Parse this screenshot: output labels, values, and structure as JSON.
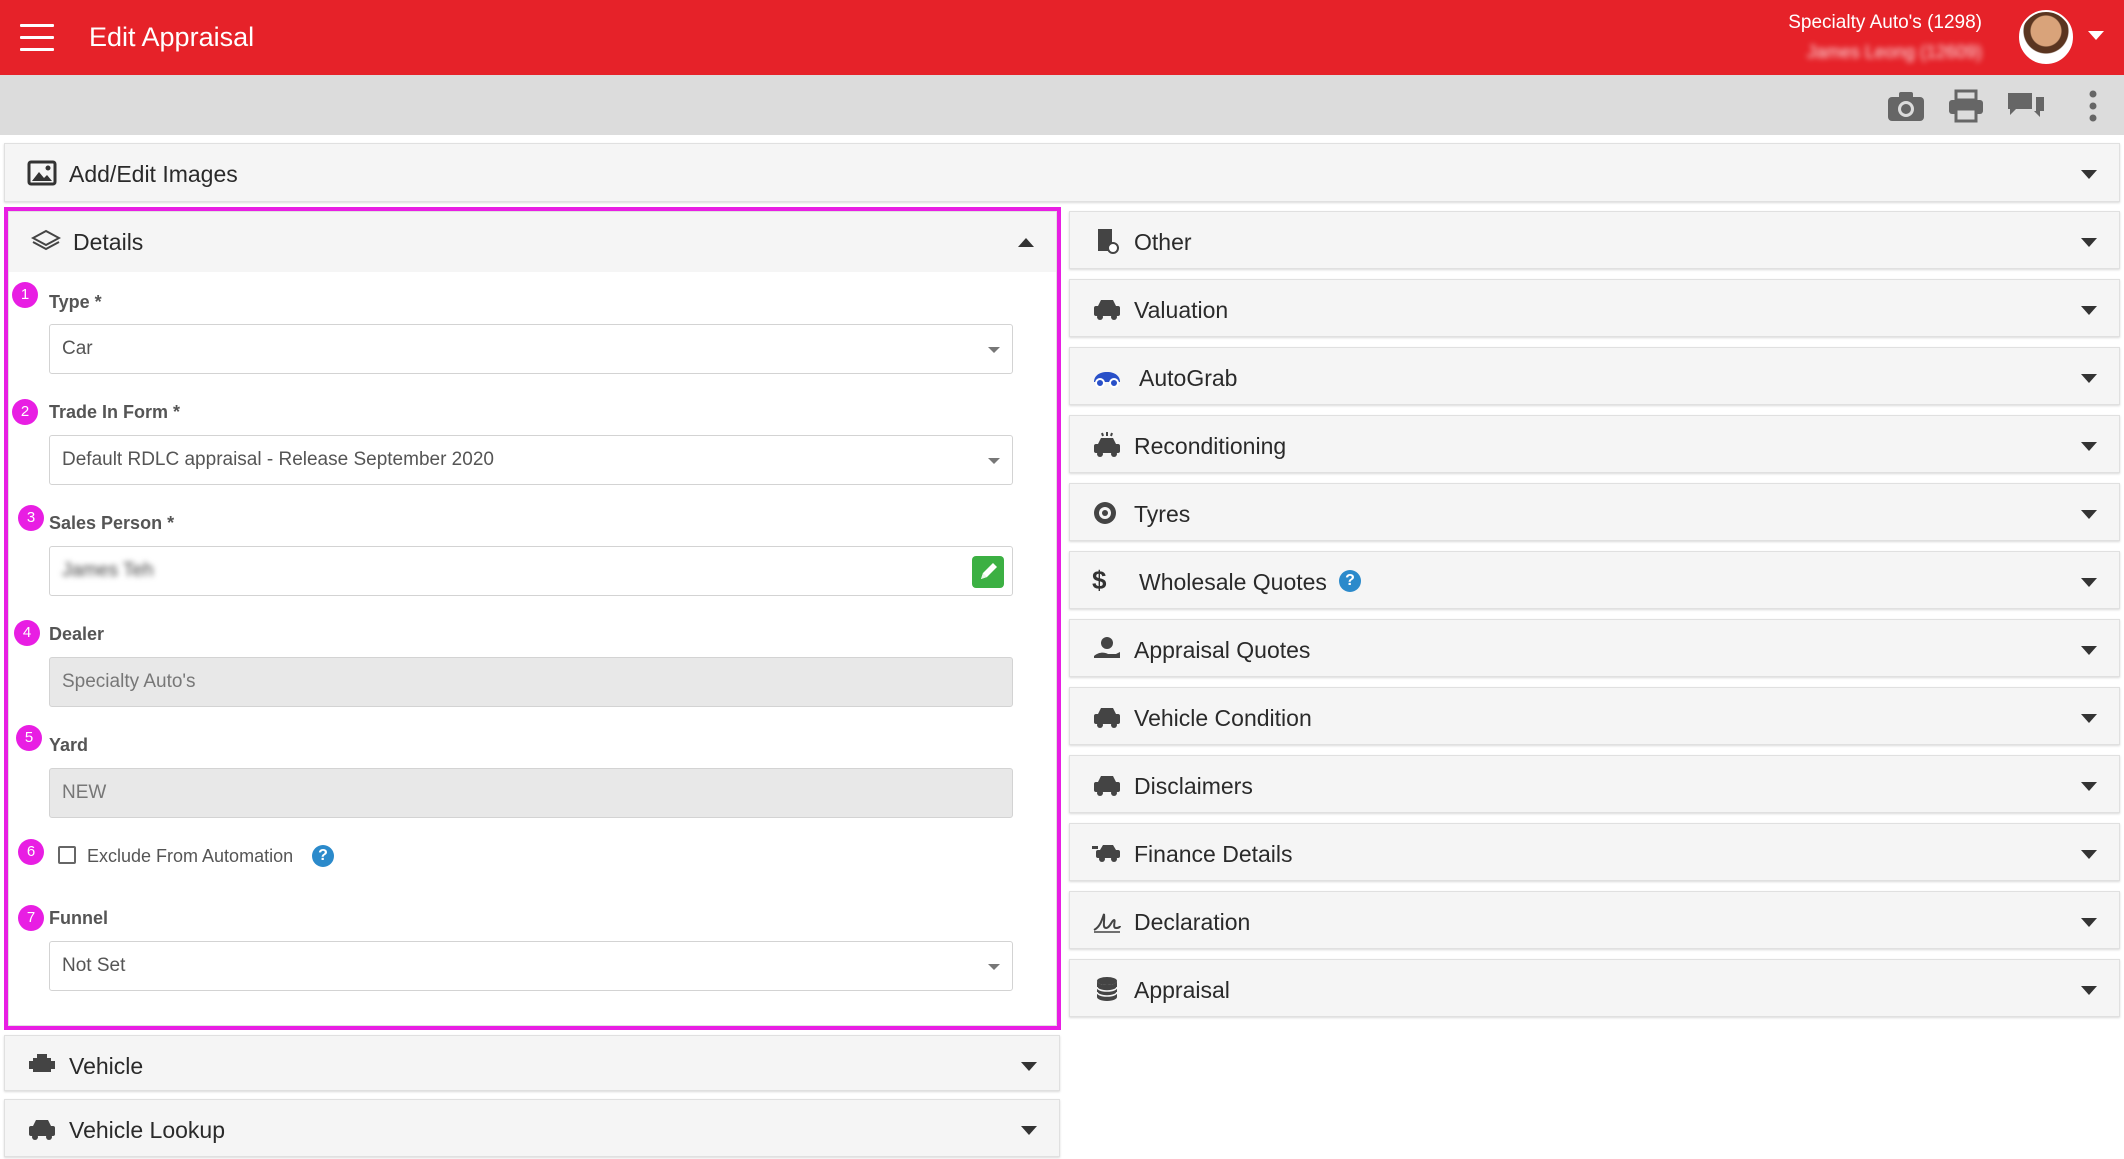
{
  "appbar": {
    "title": "Edit Appraisal",
    "dealer": "Specialty Auto's (1298)",
    "user": "James Leong (12609)"
  },
  "toolbar": {
    "icons": [
      "camera-icon",
      "print-icon",
      "chat-icon",
      "more-vert-icon"
    ]
  },
  "sections": {
    "images": "Add/Edit Images",
    "details": "Details",
    "vehicle": "Vehicle",
    "vehicle_lookup": "Vehicle Lookup"
  },
  "right_sections": [
    {
      "label": "Other",
      "icon": "document-icon"
    },
    {
      "label": "Valuation",
      "icon": "car-icon"
    },
    {
      "label": "AutoGrab",
      "icon": "autograb-logo-icon"
    },
    {
      "label": "Reconditioning",
      "icon": "car-wash-icon"
    },
    {
      "label": "Tyres",
      "icon": "tyre-icon"
    },
    {
      "label": "Wholesale Quotes",
      "icon": "dollar-icon"
    },
    {
      "label": "Appraisal Quotes",
      "icon": "hand-coin-icon"
    },
    {
      "label": "Vehicle Condition",
      "icon": "car-icon"
    },
    {
      "label": "Disclaimers",
      "icon": "car-icon"
    },
    {
      "label": "Finance Details",
      "icon": "car-money-icon"
    },
    {
      "label": "Declaration",
      "icon": "signature-icon"
    },
    {
      "label": "Appraisal",
      "icon": "database-icon"
    }
  ],
  "details": {
    "badges": [
      "1",
      "2",
      "3",
      "4",
      "5",
      "6",
      "7"
    ],
    "type_label": "Type *",
    "type_value": "Car",
    "form_label": "Trade In Form *",
    "form_value": "Default RDLC appraisal - Release September 2020",
    "salesperson_label": "Sales Person *",
    "salesperson_value": "James Teh",
    "dealer_label": "Dealer",
    "dealer_value": "Specialty Auto's",
    "yard_label": "Yard",
    "yard_value": "NEW",
    "exclude_label": "Exclude From Automation",
    "exclude_checked": false,
    "funnel_label": "Funnel",
    "funnel_value": "Not Set"
  },
  "colors": {
    "appbar": "#e62229",
    "highlight": "#e81ee3",
    "edit_button": "#3cb043",
    "help_icon": "#2b8acb",
    "autograb_icon": "#2950c8"
  }
}
